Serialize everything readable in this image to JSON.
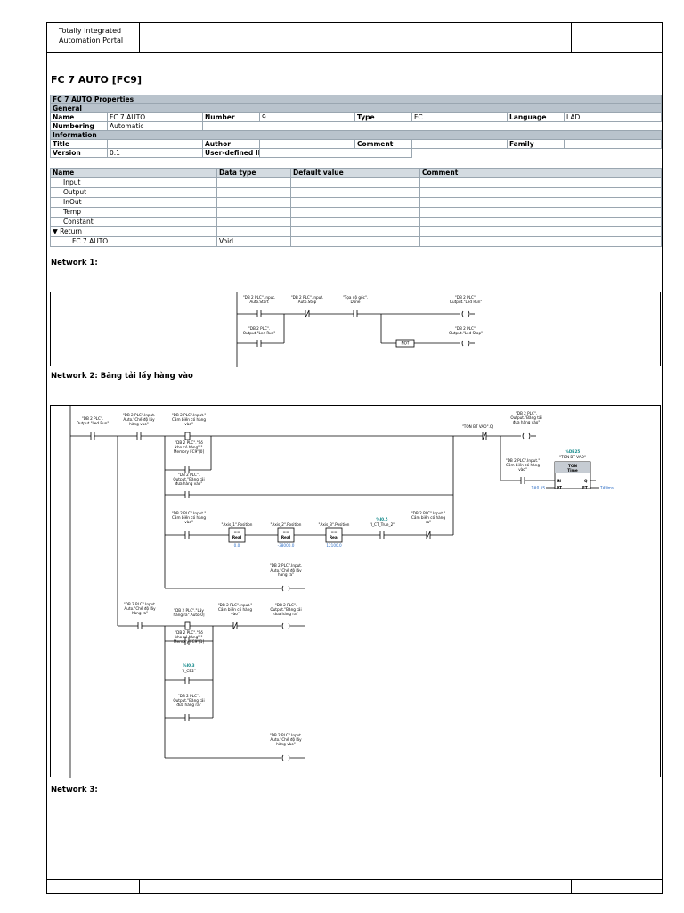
{
  "header": {
    "portal_line1": "Totally Integrated",
    "portal_line2": "Automation Portal"
  },
  "block_title": "FC 7 AUTO [FC9]",
  "properties": {
    "heading": "FC 7 AUTO Properties",
    "general_label": "General",
    "name_label": "Name",
    "name_value": "FC 7 AUTO",
    "number_label": "Number",
    "number_value": "9",
    "type_label": "Type",
    "type_value": "FC",
    "language_label": "Language",
    "language_value": "LAD",
    "numbering_label": "Numbering",
    "numbering_value": "Automatic",
    "information_label": "Information",
    "title_label": "Title",
    "author_label": "Author",
    "comment_label": "Comment",
    "family_label": "Family",
    "version_label": "Version",
    "version_value": "0.1",
    "userid_label": "User-defined ID"
  },
  "interface": {
    "columns": [
      "Name",
      "Data type",
      "Default value",
      "Comment"
    ],
    "rows": [
      {
        "name": "Input",
        "type": ""
      },
      {
        "name": "Output",
        "type": ""
      },
      {
        "name": "InOut",
        "type": ""
      },
      {
        "name": "Temp",
        "type": ""
      },
      {
        "name": "Constant",
        "type": ""
      },
      {
        "name": "Return",
        "type": ""
      },
      {
        "name": "FC 7 AUTO",
        "type": "Void"
      }
    ]
  },
  "networks": {
    "n1_title": "Network 1:",
    "n2_title": "Network 2: Băng tải lấy hàng vào",
    "n3_title": "Network 3:"
  },
  "net1": {
    "auto_start": "\"DB 2 PLC\".Input.\nAuto.Start",
    "auto_stop": "\"DB 2 PLC\".Input.\nAuto.Stop",
    "toa_do_goc": "\"Tọa độ gốc\".\nDone",
    "out_led_run": "\"DB 2 PLC\".\nOutput.\"Led Run\"",
    "led_run_contact": "\"DB 2 PLC\".\nOutput.\"Led Run\"",
    "not_label": "NOT",
    "out_led_stop": "\"DB 2 PLC\".\nOutput.\"Led Stop\""
  },
  "net2": {
    "c_led_run": "\"DB 2 PLC\".\nOutput.\"Led Run\"",
    "c_che_do_lay": "\"DB 2 PLC\".Input.\nAuto.\"Chế độ lấy\nhàng vào\"",
    "c_cam_bien_vao_p": "\"DB 2 PLC\".Input.\"\nCảm biến có hàng\nvào\"",
    "c_so_kho_0": "\"DB 2 PLC\".\"Số\nkho có hàng\".\"\nMemory FC9\"[0]",
    "c_bang_tai_vao": "\"DB 2 PLC\".\nOutput.\"Băng tải\nđưa hàng vào\"",
    "c_cam_bien_vao": "\"DB 2 PLC\".Input.\"\nCảm biến có hàng\nvào\"",
    "axis1": "\"Axis_1\".Position",
    "axis2": "\"Axis_2\".Position",
    "axis3": "\"Axis_3\".Position",
    "cmp_eq": "==",
    "cmp_type": "Real",
    "axis1_val": "0.0",
    "axis2_val": "-38000.0",
    "axis3_val": "12100.0",
    "m_addr": "%I0.5",
    "m_name": "\"I_CT_True_2\"",
    "c_cam_bien_ra_nc": "\"DB 2 PLC\".Input.\"\nCảm biến có hàng\nra\"",
    "r_che_do_ra": "\"DB 2 PLC\".Input.\nAuto.\"Chế độ lấy\nhàng ra\"",
    "ton_q": "\"TON BT VAO\".Q",
    "out_bang_tai_vao": "\"DB 2 PLC\".\nOutput.\"Băng tải\nđưa hàng vào\"",
    "ton_addr": "%DB25",
    "ton_name": "\"TON BT VAO\"",
    "ton_type": "TON",
    "ton_time": "Time",
    "ton_in": "IN",
    "ton_q_pin": "Q",
    "ton_pt": "PT",
    "ton_et": "ET",
    "ton_pt_val": "T#0.5S",
    "ton_et_val": "T#0ms",
    "ton_in_contact": "\"DB 2 PLC\".Input.\"\nCảm biến có hàng\nvào\"",
    "c_che_do_ra": "\"DB 2 PLC\".Input.\nAuto.\"Chế độ lấy\nhàng ra\"",
    "c_lay_hang_ra": "\"DB 2 PLC\".\"Lấy\nhàng ra\".Auto[0]",
    "c_cam_bien_vao_nc": "\"DB 2 PLC\".Input.\"\nCảm biến có hàng\nvào\"",
    "out_bang_tai_ra": "\"DB 2 PLC\".\nOutput.\"Băng tải\nđưa hàng ra\"",
    "c_so_kho_1": "\"DB 2 PLC\".\"Số\nkho có hàng\".\"\nMemory FC9\"[1]",
    "ic2_addr": "%I0.3",
    "ic2_name": "\"I_CB2\"",
    "c_bang_tai_ra": "\"DB 2 PLC\".\nOutput.\"Băng tải\nđưa hàng ra\"",
    "r_che_do_vao": "\"DB 2 PLC\".Input.\nAuto.\"Chế độ lấy\nhàng vào\""
  },
  "colors": {
    "section_bg": "#b9c3cc",
    "teal": "#13898a",
    "blue_value": "#2b6cc4",
    "ton_box": "#c6ccd3"
  }
}
